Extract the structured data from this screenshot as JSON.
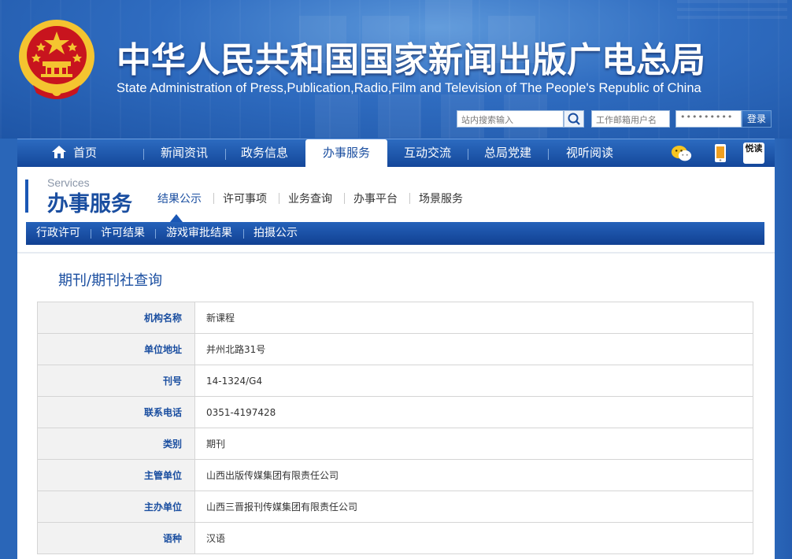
{
  "header": {
    "title_cn": "中华人民共和国国家新闻出版广电总局",
    "title_en": "State Administration of Press,Publication,Radio,Film and Television of The People's Republic of China",
    "search_placeholder": "站内搜索输入",
    "mail_user_placeholder": "工作邮箱用户名",
    "mail_password_mask": "•••••••••",
    "login_label": "登录"
  },
  "main_nav": {
    "items": [
      {
        "label": "首页"
      },
      {
        "label": "新闻资讯"
      },
      {
        "label": "政务信息"
      },
      {
        "label": "办事服务"
      },
      {
        "label": "互动交流"
      },
      {
        "label": "总局党建"
      },
      {
        "label": "视听阅读"
      }
    ],
    "active_index": 3,
    "reader_icon_text": "悦读"
  },
  "section": {
    "label_en": "Services",
    "label_cn": "办事服务",
    "sub_nav": [
      {
        "label": "结果公示"
      },
      {
        "label": "许可事项"
      },
      {
        "label": "业务查询"
      },
      {
        "label": "办事平台"
      },
      {
        "label": "场景服务"
      }
    ],
    "third_nav": [
      {
        "label": "行政许可"
      },
      {
        "label": "许可结果"
      },
      {
        "label": "游戏审批结果"
      },
      {
        "label": "拍摄公示"
      }
    ]
  },
  "page": {
    "title": "期刊/期刊社查询",
    "rows": [
      {
        "key": "机构名称",
        "value": "新课程"
      },
      {
        "key": "单位地址",
        "value": "并州北路31号"
      },
      {
        "key": "刊号",
        "value": "14-1324/G4"
      },
      {
        "key": "联系电话",
        "value": "0351-4197428"
      },
      {
        "key": "类别",
        "value": "期刊"
      },
      {
        "key": "主管单位",
        "value": "山西出版传媒集团有限责任公司"
      },
      {
        "key": "主办单位",
        "value": "山西三晋报刊传媒集团有限责任公司"
      },
      {
        "key": "语种",
        "value": "汉语"
      }
    ]
  },
  "colors": {
    "brand_blue": "#1a4ea0",
    "header_blue": "#2f6cc0",
    "emblem_red": "#c8141e",
    "emblem_gold": "#f4c430"
  },
  "icons": [
    "national-emblem-icon",
    "home-icon",
    "search-icon",
    "wechat-icon",
    "mobile-icon",
    "reader-icon"
  ]
}
